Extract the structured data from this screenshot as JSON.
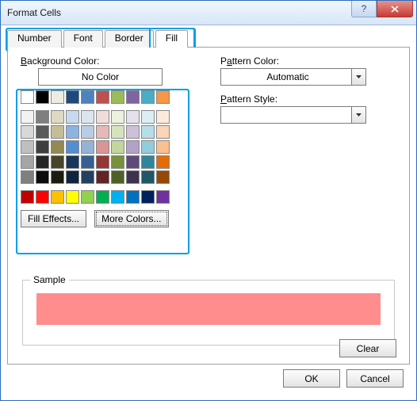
{
  "title": "Format Cells",
  "tabs": [
    "Number",
    "Font",
    "Border",
    "Fill"
  ],
  "active_tab": 3,
  "bg_label": "Background Color:",
  "nocolor": "No Color",
  "fill_effects": "Fill Effects...",
  "more_colors": "More Colors...",
  "pattern_color_label": "Pattern Color:",
  "pattern_color_value": "Automatic",
  "pattern_style_label": "Pattern Style:",
  "pattern_style_value": "",
  "sample_label": "Sample",
  "sample_color": "#ff8d8d",
  "clear": "Clear",
  "ok": "OK",
  "cancel": "Cancel",
  "theme_row1": [
    "#ffffff",
    "#000000",
    "#eeece1",
    "#1f497d",
    "#4f81bd",
    "#c0504d",
    "#9bbb59",
    "#8064a2",
    "#4bacc6",
    "#f79646"
  ],
  "theme_rows": [
    [
      "#f2f2f2",
      "#7f7f7f",
      "#ddd9c3",
      "#c6d9f0",
      "#dbe5f1",
      "#f2dcdb",
      "#ebf1dd",
      "#e5e0ec",
      "#dbeef3",
      "#fdeada"
    ],
    [
      "#d8d8d8",
      "#595959",
      "#c4bd97",
      "#8db3e2",
      "#b8cce4",
      "#e5b9b7",
      "#d7e3bc",
      "#ccc1d9",
      "#b7dde8",
      "#fbd5b5"
    ],
    [
      "#bfbfbf",
      "#3f3f3f",
      "#938953",
      "#548dd4",
      "#95b3d7",
      "#d99694",
      "#c3d69b",
      "#b2a2c7",
      "#92cddc",
      "#fac08f"
    ],
    [
      "#a5a5a5",
      "#262626",
      "#494429",
      "#17365d",
      "#366092",
      "#953734",
      "#76923c",
      "#5f497a",
      "#31859b",
      "#e36c09"
    ],
    [
      "#7f7f7f",
      "#0c0c0c",
      "#1d1b10",
      "#0f243e",
      "#244061",
      "#632423",
      "#4f6128",
      "#3f3151",
      "#205867",
      "#974806"
    ]
  ],
  "standard": [
    "#c00000",
    "#ff0000",
    "#ffc000",
    "#ffff00",
    "#92d050",
    "#00b050",
    "#00b0f0",
    "#0070c0",
    "#002060",
    "#7030a0"
  ]
}
